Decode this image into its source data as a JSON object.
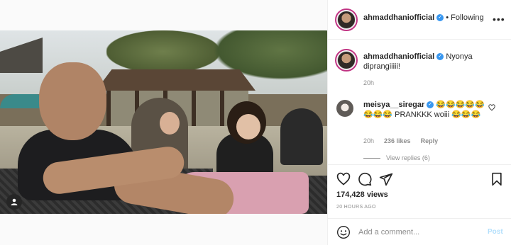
{
  "post": {
    "author": "ahmaddhaniofficial",
    "follow_separator": "•",
    "follow_status": "Following",
    "more_label": "•••",
    "caption_author": "ahmaddhaniofficial",
    "caption_text": "Nyonya diprangiiiii!",
    "caption_time": "20h"
  },
  "comment": {
    "author": "meisya__siregar",
    "text": "😂😂😂😂😂😂😂😂 PRANKKK woiii 😂😂😂",
    "time": "20h",
    "likes": "236 likes",
    "reply_label": "Reply",
    "view_replies": "View replies (6)"
  },
  "stats": {
    "views": "174,428 views",
    "ago": "20 HOURS AGO"
  },
  "composer": {
    "placeholder": "Add a comment...",
    "post_label": "Post"
  },
  "colors": {
    "link": "#3897f0",
    "post_disabled": "#b2dffc",
    "muted": "#8e8e8e"
  },
  "icons": [
    "heart-icon",
    "comment-icon",
    "share-icon",
    "bookmark-icon",
    "emoji-icon",
    "user-tag-icon",
    "mute-icon",
    "verified-icon",
    "more-icon"
  ]
}
